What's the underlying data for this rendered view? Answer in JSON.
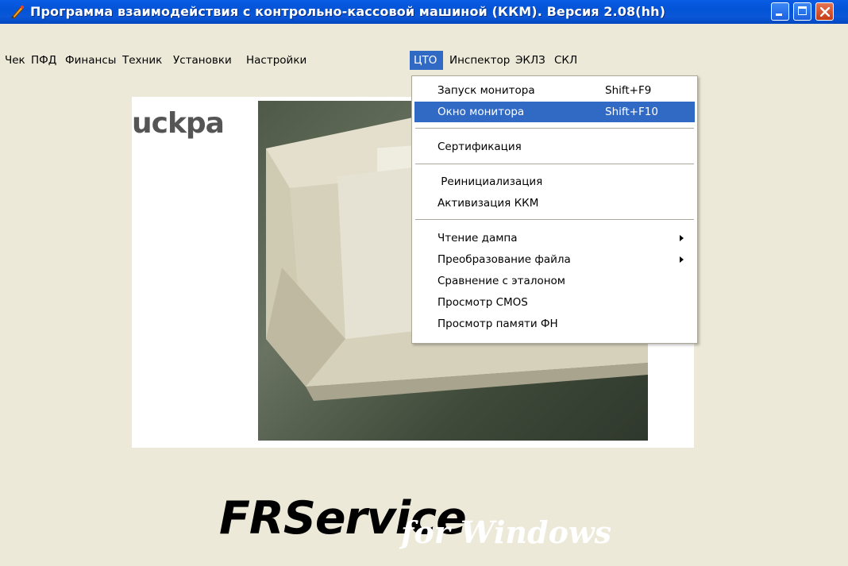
{
  "window": {
    "title": "Программа взаимодействия с контрольно-кассовой машиной (ККМ). Версия 2.08(hh)"
  },
  "menubar": {
    "items": [
      {
        "label": "Чек"
      },
      {
        "label": "ПФД"
      },
      {
        "label": "Финансы"
      },
      {
        "label": "Техник"
      },
      {
        "label": "Установки"
      },
      {
        "label": "Настройки"
      },
      {
        "label": "ЦТО",
        "active": true
      },
      {
        "label": "Инспектор"
      },
      {
        "label": "ЭКЛЗ"
      },
      {
        "label": "СКЛ"
      }
    ]
  },
  "dropdown": {
    "items": [
      {
        "label": "Запуск монитора",
        "shortcut": "Shift+F9"
      },
      {
        "label": "Окно монитора",
        "shortcut": "Shift+F10",
        "highlighted": true
      },
      {
        "label": "Сертификация"
      },
      {
        "label": " Реинициализация"
      },
      {
        "label": "Активизация ККМ"
      },
      {
        "label": "Чтение дампа",
        "submenu": true
      },
      {
        "label": "Преобразование файла",
        "submenu": true
      },
      {
        "label": "Сравнение с эталоном"
      },
      {
        "label": "Просмотр CMOS"
      },
      {
        "label": "Просмотр памяти ФН"
      }
    ]
  },
  "splash": {
    "logo_text": "uckpa",
    "product_text": "FRService",
    "product_suffix": "for Windows"
  },
  "colors": {
    "titlebar": "#0353d6",
    "menu_highlight": "#316ac5",
    "background": "#ece9d8"
  }
}
